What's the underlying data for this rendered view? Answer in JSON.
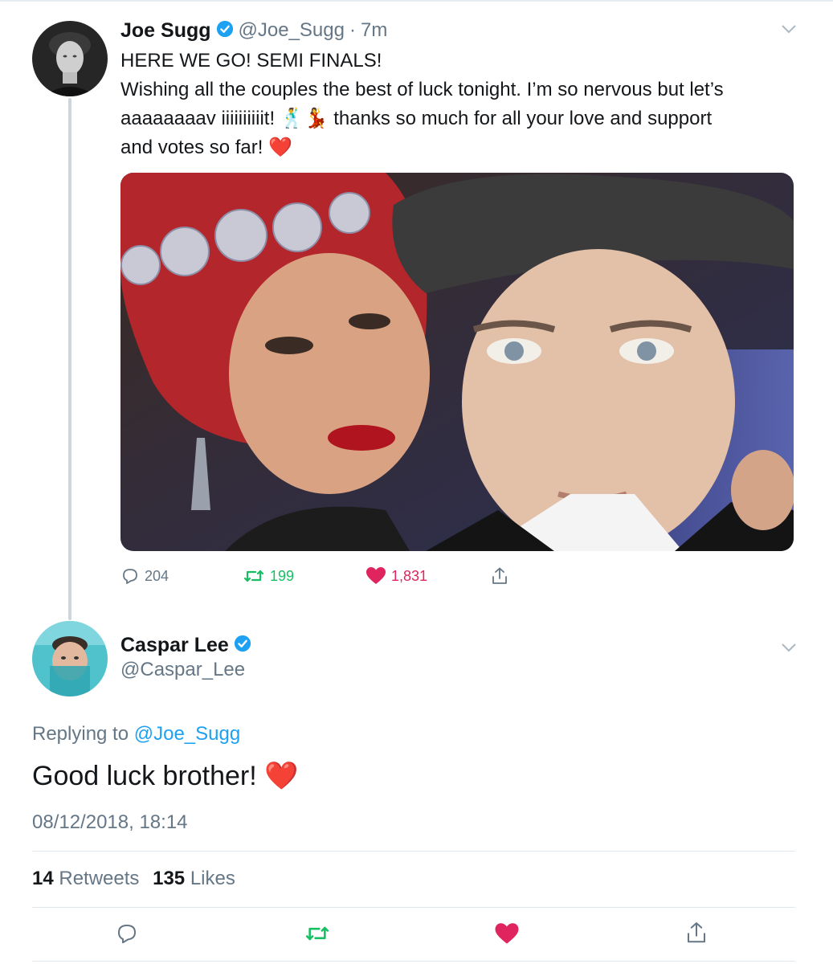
{
  "tweet": {
    "author_name": "Joe Sugg",
    "handle": "@Joe_Sugg",
    "age": "7m",
    "separator": "·",
    "lines": [
      "HERE WE GO! SEMI FINALS!",
      "Wishing all the couples the best of luck tonight. I’m so nervous but let’s",
      "aaaaaaaav iiiiiiiiiit! 🕺💃 thanks so much for all your love and support",
      "and votes so far! ❤️"
    ],
    "actions": {
      "replies": "204",
      "retweets": "199",
      "likes": "1,831"
    }
  },
  "reply": {
    "author_name": "Caspar Lee",
    "handle": "@Caspar_Lee",
    "replying_prefix": "Replying to",
    "replying_to": "@Joe_Sugg",
    "text": "Good luck brother! ❤️",
    "timestamp": "08/12/2018, 18:14",
    "retweet_count": "14",
    "retweet_label": "Retweets",
    "like_count": "135",
    "like_label": "Likes"
  },
  "icons": {
    "verified": "verified-badge-icon",
    "chevron": "chevron-down-icon",
    "reply": "reply-icon",
    "retweet": "retweet-icon",
    "like": "heart-icon",
    "share": "share-icon"
  },
  "colors": {
    "link_blue": "#1da1f2",
    "retweet_green": "#17bf63",
    "like_red": "#e0245e",
    "muted_gray": "#657786",
    "text_dark": "#14171a"
  }
}
